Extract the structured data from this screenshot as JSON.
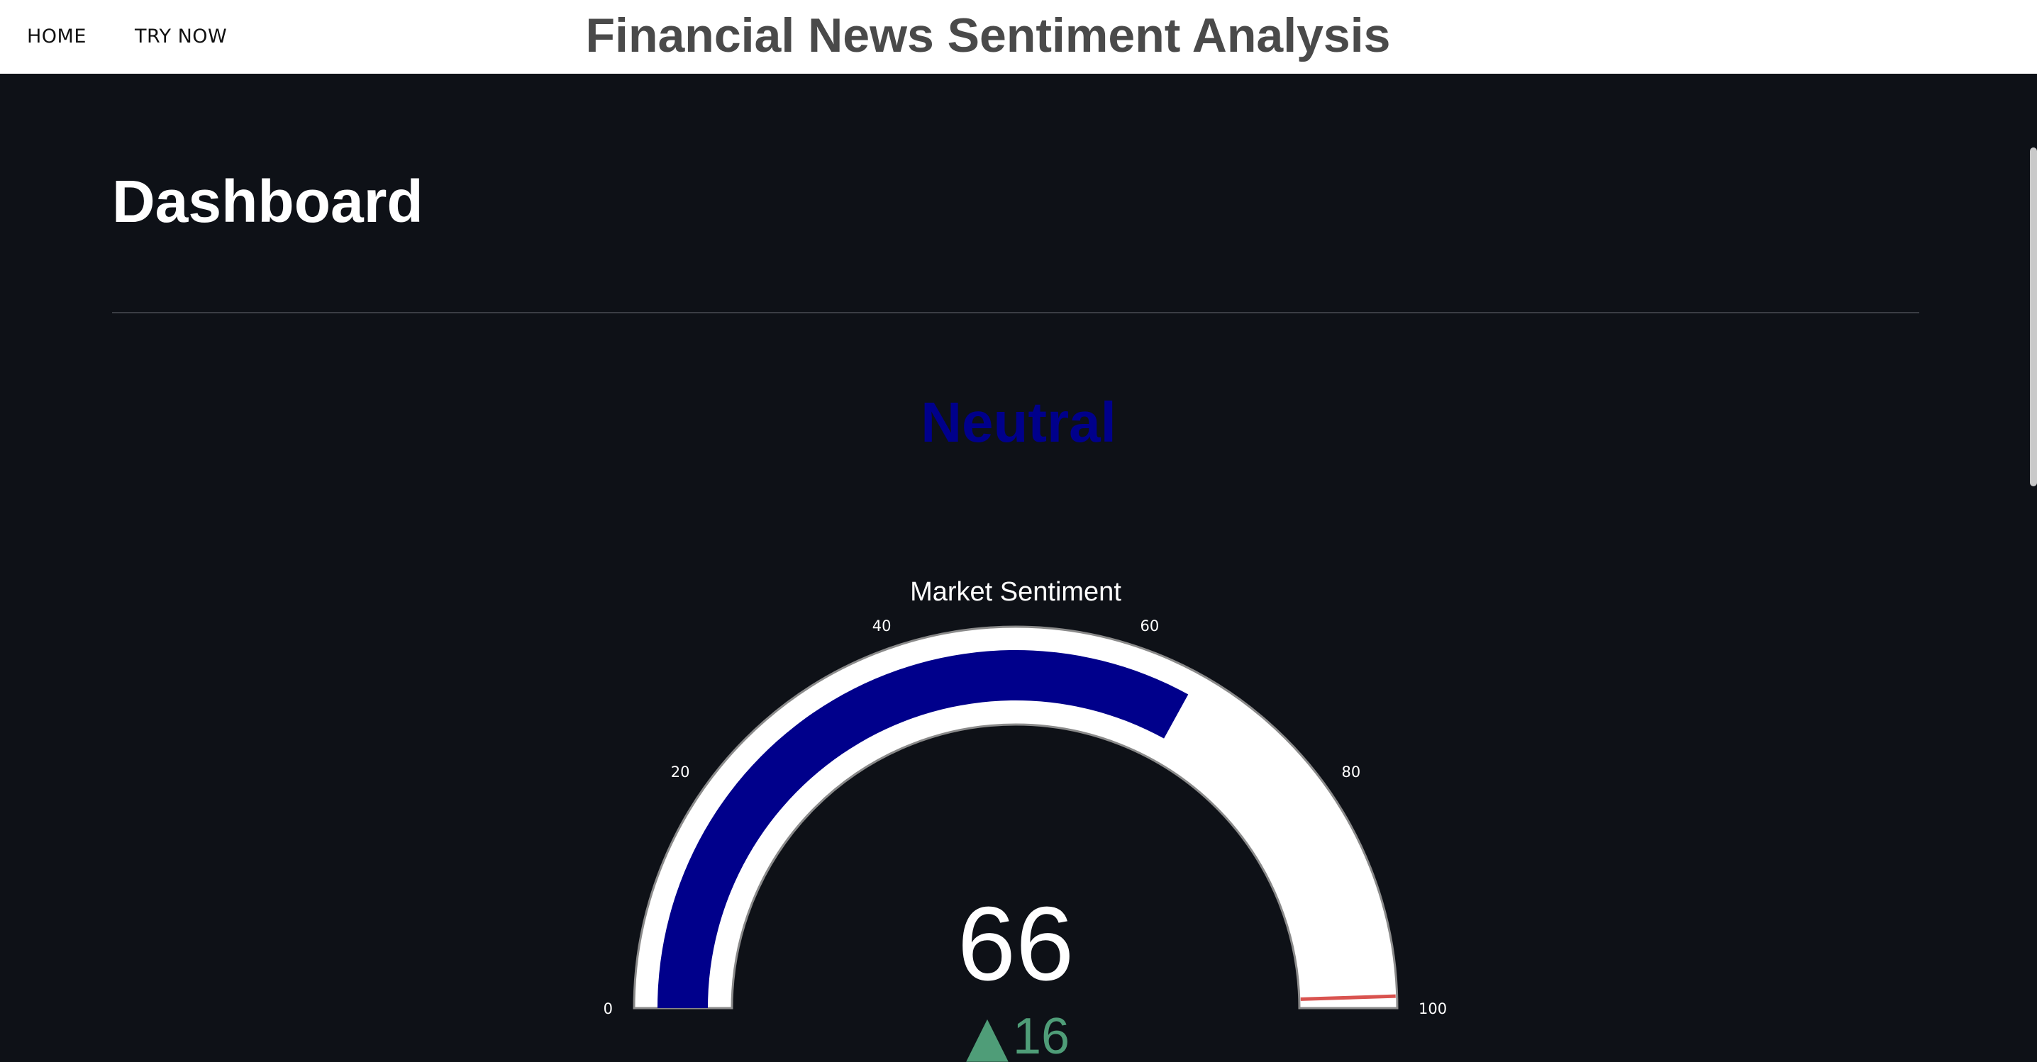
{
  "nav": {
    "home_label": "HOME",
    "try_now_label": "TRY NOW"
  },
  "header": {
    "title": "Financial News Sentiment Analysis"
  },
  "main": {
    "title": "Dashboard",
    "sentiment_label": "Neutral",
    "sentiment_color": "#00008b"
  },
  "gauge": {
    "title": "Market Sentiment",
    "value": 66,
    "delta": 16,
    "delta_symbol": "▲",
    "delta_color": "#4f9d78",
    "min": 0,
    "max": 100,
    "ticks": [
      "0",
      "20",
      "40",
      "60",
      "80",
      "100"
    ],
    "bar_color": "#00008b",
    "track_color": "#ffffff",
    "threshold_value": 99,
    "threshold_color": "#d9534f"
  }
}
